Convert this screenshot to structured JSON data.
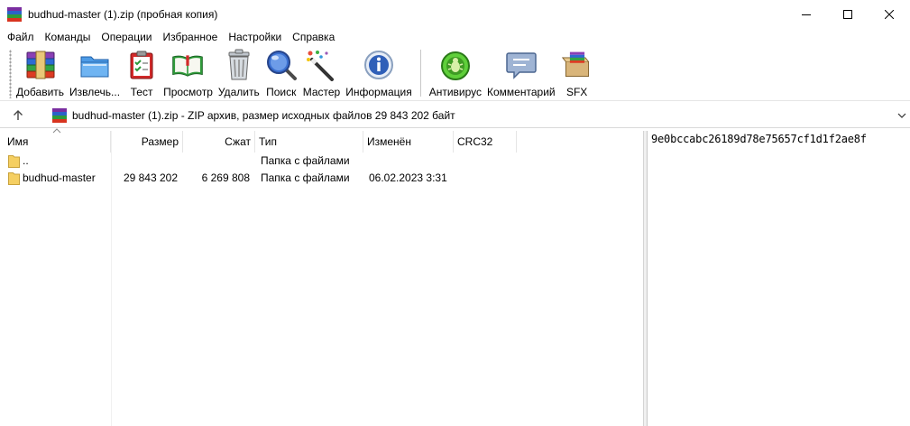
{
  "window": {
    "title": "budhud-master (1).zip (пробная копия)",
    "controls": [
      "minimize",
      "maximize",
      "close"
    ]
  },
  "menu": {
    "items": [
      "Файл",
      "Команды",
      "Операции",
      "Избранное",
      "Настройки",
      "Справка"
    ]
  },
  "toolbar": {
    "buttons": [
      {
        "label": "Добавить",
        "icon": "add-archive-icon"
      },
      {
        "label": "Извлечь...",
        "icon": "extract-icon"
      },
      {
        "label": "Тест",
        "icon": "test-icon"
      },
      {
        "label": "Просмотр",
        "icon": "view-icon"
      },
      {
        "label": "Удалить",
        "icon": "delete-icon"
      },
      {
        "label": "Поиск",
        "icon": "find-icon"
      },
      {
        "label": "Мастер",
        "icon": "wizard-icon"
      },
      {
        "label": "Информация",
        "icon": "info-icon"
      },
      {
        "label": "Антивирус",
        "icon": "antivirus-icon"
      },
      {
        "label": "Комментарий",
        "icon": "comment-icon"
      },
      {
        "label": "SFX",
        "icon": "sfx-icon"
      }
    ]
  },
  "address": {
    "text": "budhud-master (1).zip - ZIP архив, размер исходных файлов 29 843 202 байт"
  },
  "filelist": {
    "columns": [
      "Имя",
      "Размер",
      "Сжат",
      "Тип",
      "Изменён",
      "CRC32"
    ],
    "rows": [
      {
        "name": "..",
        "size": "",
        "packed": "",
        "type": "Папка с файлами",
        "modified": "",
        "crc": ""
      },
      {
        "name": "budhud-master",
        "size": "29 843 202",
        "packed": "6 269 808",
        "type": "Папка с файлами",
        "modified": "06.02.2023 3:31",
        "crc": ""
      }
    ]
  },
  "infopane": {
    "hash": "9e0bccabc26189d78e75657cf1d1f2ae8f"
  },
  "colors": {
    "accent": "#0078d7",
    "folder": "#f5cf62"
  }
}
